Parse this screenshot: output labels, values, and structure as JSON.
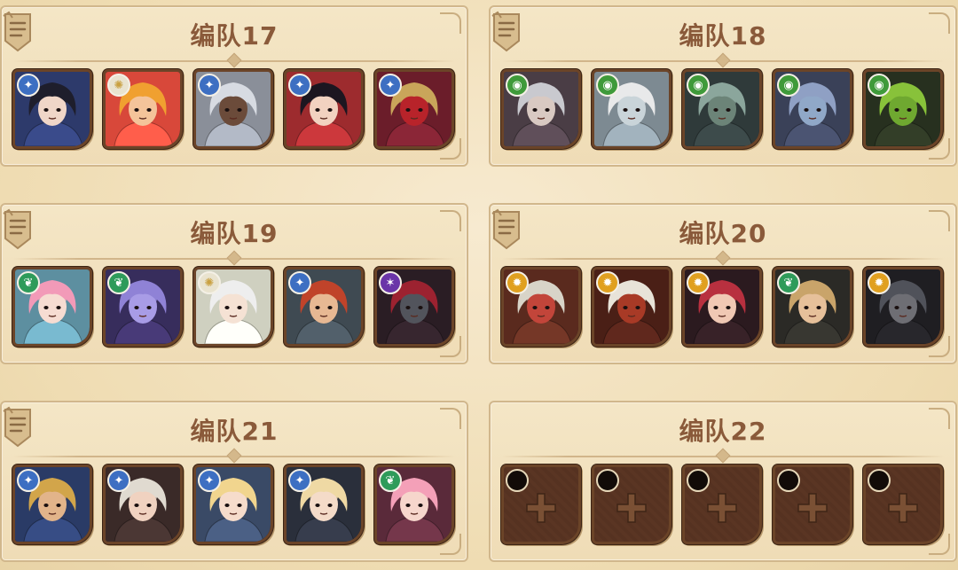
{
  "factions": {
    "lightbearer": {
      "symbol": "✦",
      "color": "#3d6fc2"
    },
    "celestial": {
      "symbol": "✺",
      "color": "#e9e3cf"
    },
    "graveborn": {
      "symbol": "◉",
      "color": "#3f9a3a"
    },
    "wilder": {
      "symbol": "❦",
      "color": "#2e9b5a"
    },
    "hypogean": {
      "symbol": "✶",
      "color": "#6a35a8"
    },
    "maulers": {
      "symbol": "✹",
      "color": "#e0a020"
    }
  },
  "teams": [
    {
      "title": "编队17",
      "heroes": [
        {
          "faction": "lightbearer",
          "color": "#2d3a6b",
          "hair": "#1e1e2c",
          "skin": "#f0d6c8"
        },
        {
          "faction": "celestial",
          "color": "#d8483a",
          "hair": "#f0a030",
          "skin": "#f4c49a"
        },
        {
          "faction": "lightbearer",
          "color": "#8a8f99",
          "hair": "#d7dbe2",
          "skin": "#6b4b3a"
        },
        {
          "faction": "lightbearer",
          "color": "#9d2b2e",
          "hair": "#1c1620",
          "skin": "#f2d2c0"
        },
        {
          "faction": "lightbearer",
          "color": "#6b1d2a",
          "hair": "#c9a55a",
          "skin": "#b8232a"
        }
      ]
    },
    {
      "title": "编队18",
      "heroes": [
        {
          "faction": "graveborn",
          "color": "#4a3d45",
          "hair": "#c9c9cf",
          "skin": "#d9c9c2"
        },
        {
          "faction": "graveborn",
          "color": "#7d8a92",
          "hair": "#e8e9ea",
          "skin": "#c9d4d9"
        },
        {
          "faction": "graveborn",
          "color": "#2f3a3a",
          "hair": "#8ba69c",
          "skin": "#6c8478"
        },
        {
          "faction": "graveborn",
          "color": "#3a4158",
          "hair": "#8fa0c4",
          "skin": "#90a8c8"
        },
        {
          "faction": "graveborn",
          "color": "#27301f",
          "hair": "#88c23a",
          "skin": "#6fa830"
        }
      ]
    },
    {
      "title": "编队19",
      "heroes": [
        {
          "faction": "wilder",
          "color": "#5d8fa0",
          "hair": "#f29ab8",
          "skin": "#f6dcd2"
        },
        {
          "faction": "wilder",
          "color": "#372d5c",
          "hair": "#8f82d6",
          "skin": "#a89ce6"
        },
        {
          "faction": "celestial",
          "color": "#cfd0c0",
          "hair": "#eeeeee",
          "skin": "#f5e2d4"
        },
        {
          "faction": "lightbearer",
          "color": "#3f4a52",
          "hair": "#c0432a",
          "skin": "#e7b893"
        },
        {
          "faction": "hypogean",
          "color": "#2a1d24",
          "hair": "#9c2230",
          "skin": "#52545c"
        }
      ]
    },
    {
      "title": "编队20",
      "heroes": [
        {
          "faction": "maulers",
          "color": "#5a2a1e",
          "hair": "#d8d4c8",
          "skin": "#c2453a"
        },
        {
          "faction": "maulers",
          "color": "#4a1f16",
          "hair": "#e8e3d8",
          "skin": "#a83a26"
        },
        {
          "faction": "maulers",
          "color": "#2b1a1f",
          "hair": "#b8303f",
          "skin": "#f0c8b4"
        },
        {
          "faction": "wilder",
          "color": "#2b2a26",
          "hair": "#c9a46a",
          "skin": "#e6c09a"
        },
        {
          "faction": "maulers",
          "color": "#1f1e22",
          "hair": "#50525a",
          "skin": "#6e6e74"
        }
      ]
    },
    {
      "title": "编队21",
      "heroes": [
        {
          "faction": "lightbearer",
          "color": "#2a3b66",
          "hair": "#d2a54a",
          "skin": "#e2b48a"
        },
        {
          "faction": "lightbearer",
          "color": "#3a2a28",
          "hair": "#e0dad0",
          "skin": "#f0d2c0"
        },
        {
          "faction": "lightbearer",
          "color": "#3a4a66",
          "hair": "#f1d58e",
          "skin": "#f6dccb"
        },
        {
          "faction": "lightbearer",
          "color": "#2a2f3b",
          "hair": "#efd9a4",
          "skin": "#f4dbc8"
        },
        {
          "faction": "wilder",
          "color": "#5a2a3a",
          "hair": "#f4a0b8",
          "skin": "#f6d6cc"
        }
      ]
    },
    {
      "title": "编队22",
      "empty": true,
      "heroes": [
        {},
        {},
        {},
        {},
        {}
      ]
    }
  ]
}
